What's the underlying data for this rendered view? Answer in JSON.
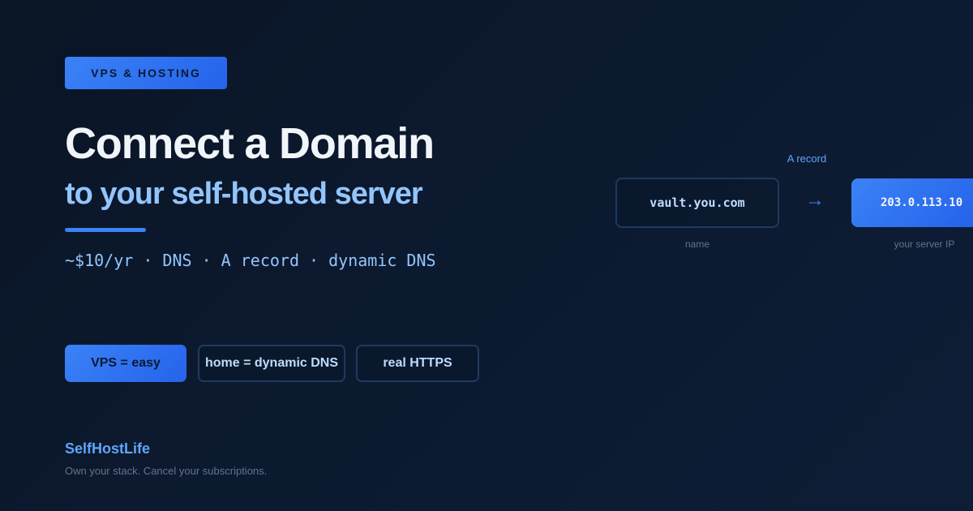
{
  "badge": "VPS & HOSTING",
  "title": "Connect a Domain",
  "subtitle": "to your self-hosted server",
  "tagline": "~$10/yr · DNS · A record · dynamic DNS",
  "pills": [
    {
      "label": "VPS = easy",
      "style": "filled"
    },
    {
      "label": "home = dynamic DNS",
      "style": "outline"
    },
    {
      "label": "real HTTPS",
      "style": "outline"
    }
  ],
  "diagram": {
    "record_label": "A record",
    "name_value": "vault.you.com",
    "name_caption": "name",
    "arrow": "→",
    "ip_value": "203.0.113.10",
    "ip_caption": "your server IP"
  },
  "footer": {
    "brand": "SelfHostLife",
    "tagline": "Own your stack. Cancel your subscriptions."
  },
  "colors": {
    "background": "#0b1628",
    "accent": "#3b82f6",
    "accent_light": "#93c5fd",
    "brand": "#60a5fa",
    "muted": "#64748b"
  }
}
